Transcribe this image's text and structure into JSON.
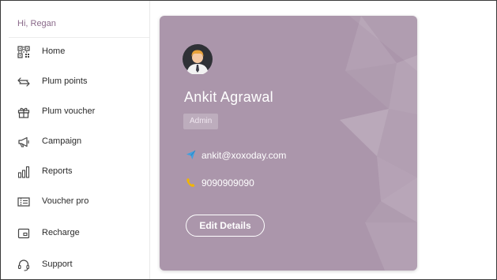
{
  "sidebar": {
    "greeting": "Hi, Regan",
    "items": [
      {
        "label": "Home",
        "icon": "qr-code-icon"
      },
      {
        "label": "Plum points",
        "icon": "exchange-arrows-icon"
      },
      {
        "label": "Plum voucher",
        "icon": "gift-box-icon"
      },
      {
        "label": "Campaign",
        "icon": "megaphone-icon"
      },
      {
        "label": "Reports",
        "icon": "bar-chart-icon"
      },
      {
        "label": "Voucher pro",
        "icon": "voucher-ticket-icon"
      },
      {
        "label": "Recharge",
        "icon": "recharge-card-icon"
      },
      {
        "label": "Support",
        "icon": "headset-icon"
      }
    ]
  },
  "profile": {
    "name": "Ankit Agrawal",
    "role": "Admin",
    "email": "ankit@xoxoday.com",
    "phone": "9090909090",
    "edit_label": "Edit Details"
  },
  "colors": {
    "card_background": "#ab96ab",
    "greeting_text": "#8a6a8a",
    "email_icon": "#3fa0e0",
    "phone_icon": "#f2b600"
  }
}
